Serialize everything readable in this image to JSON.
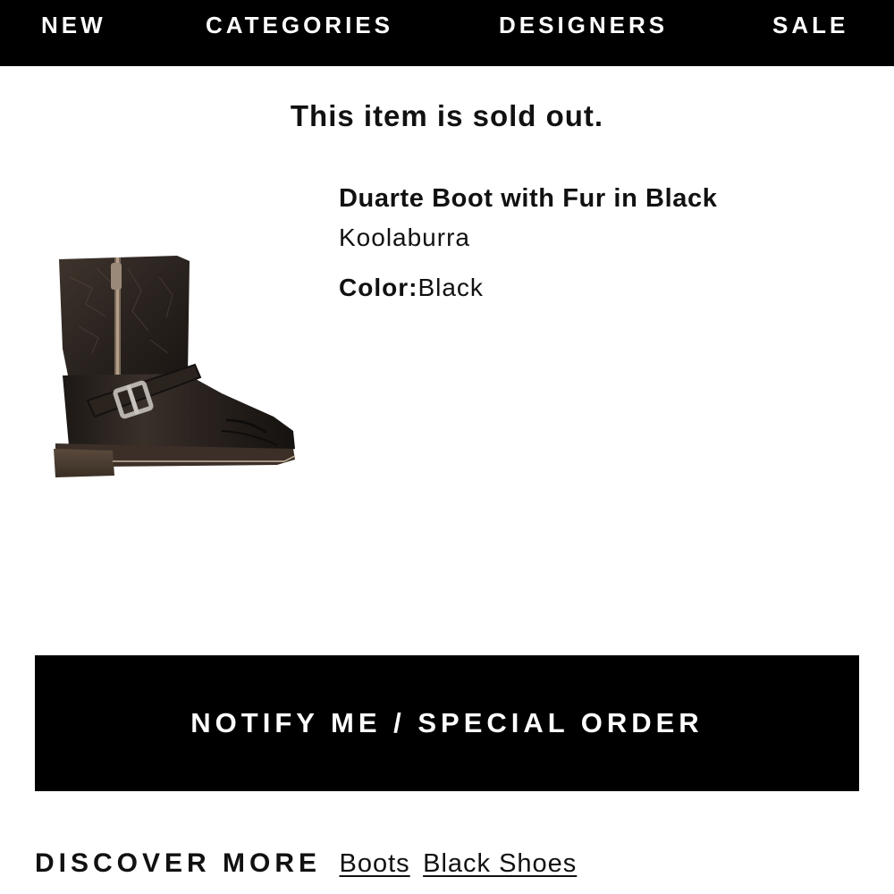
{
  "nav": {
    "items": [
      {
        "label": "NEW"
      },
      {
        "label": "CATEGORIES"
      },
      {
        "label": "DESIGNERS"
      },
      {
        "label": "SALE"
      }
    ]
  },
  "notice": {
    "sold_out": "This item is sold out."
  },
  "product": {
    "name": "Duarte Boot with Fur in Black",
    "brand": "Koolaburra",
    "color_label": "Color:",
    "color_value": "Black",
    "image_icon": "black-leather-ankle-boot-image"
  },
  "cta": {
    "label": "NOTIFY ME / SPECIAL ORDER"
  },
  "discover": {
    "heading": "DISCOVER MORE",
    "links": [
      {
        "label": "Boots"
      },
      {
        "label": "Black Shoes"
      }
    ]
  },
  "colors": {
    "nav_bg": "#000000",
    "nav_text": "#ffffff",
    "button_bg": "#000000",
    "button_text": "#ffffff",
    "text": "#111111"
  }
}
